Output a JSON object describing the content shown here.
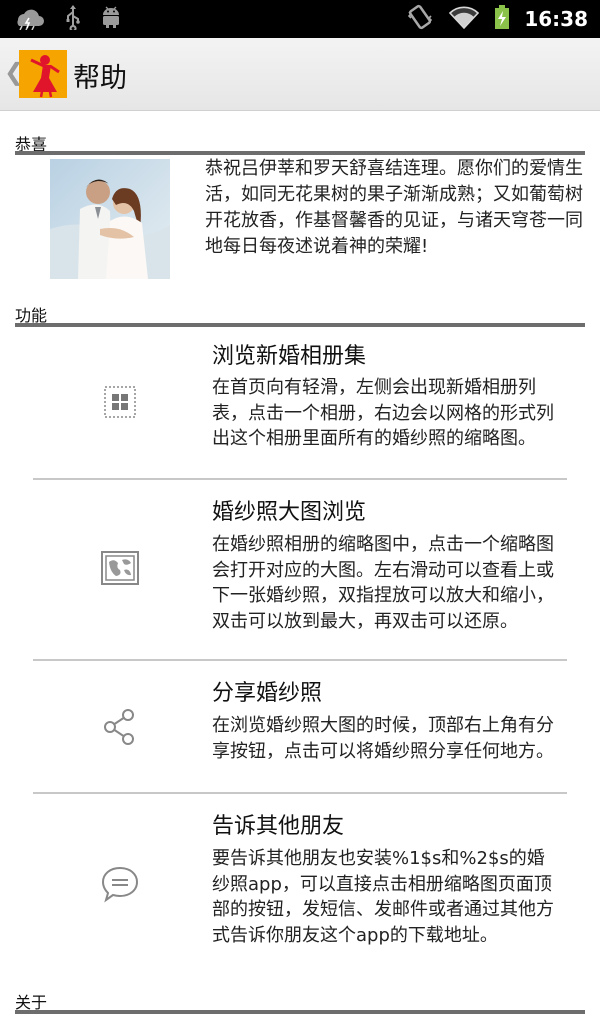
{
  "status_bar": {
    "time": "16:38",
    "icons": [
      "weather-icon",
      "usb-icon",
      "android-debug-icon",
      "vibrate-icon",
      "wifi-icon",
      "battery-charging-icon"
    ]
  },
  "action_bar": {
    "title": "帮助",
    "back_icon": "chevron-left-icon",
    "logo_color": "#f5a400"
  },
  "sections": {
    "congrats": {
      "header": "恭喜",
      "text": "恭祝吕伊莘和罗天舒喜结连理。愿你们的爱情生活，如同无花果树的果子渐渐成熟；又如葡萄树开花放香，作基督馨香的见证，与诸天穹苍一同地每日每夜述说着神的荣耀!"
    },
    "features": {
      "header": "功能",
      "items": [
        {
          "icon": "grid-icon",
          "title": "浏览新婚相册集",
          "desc": "在首页向有轻滑，左侧会出现新婚相册列表，点击一个相册，右边会以网格的形式列出这个相册里面所有的婚纱照的缩略图。"
        },
        {
          "icon": "picture-icon",
          "title": "婚纱照大图浏览",
          "desc": "在婚纱照相册的缩略图中，点击一个缩略图会打开对应的大图。左右滑动可以查看上或下一张婚纱照，双指捏放可以放大和缩小，双击可以放到最大，再双击可以还原。"
        },
        {
          "icon": "share-icon",
          "title": "分享婚纱照",
          "desc": "在浏览婚纱照大图的时候，顶部右上角有分享按钮，点击可以将婚纱照分享任何地方。"
        },
        {
          "icon": "chat-bubble-icon",
          "title": "告诉其他朋友",
          "desc": "要告诉其他朋友也安装%1$s和%2$s的婚纱照app，可以直接点击相册缩略图页面顶部的按钮，发短信、发邮件或者通过其他方式告诉你朋友这个app的下载地址。"
        }
      ]
    },
    "about": {
      "header": "关于"
    }
  }
}
